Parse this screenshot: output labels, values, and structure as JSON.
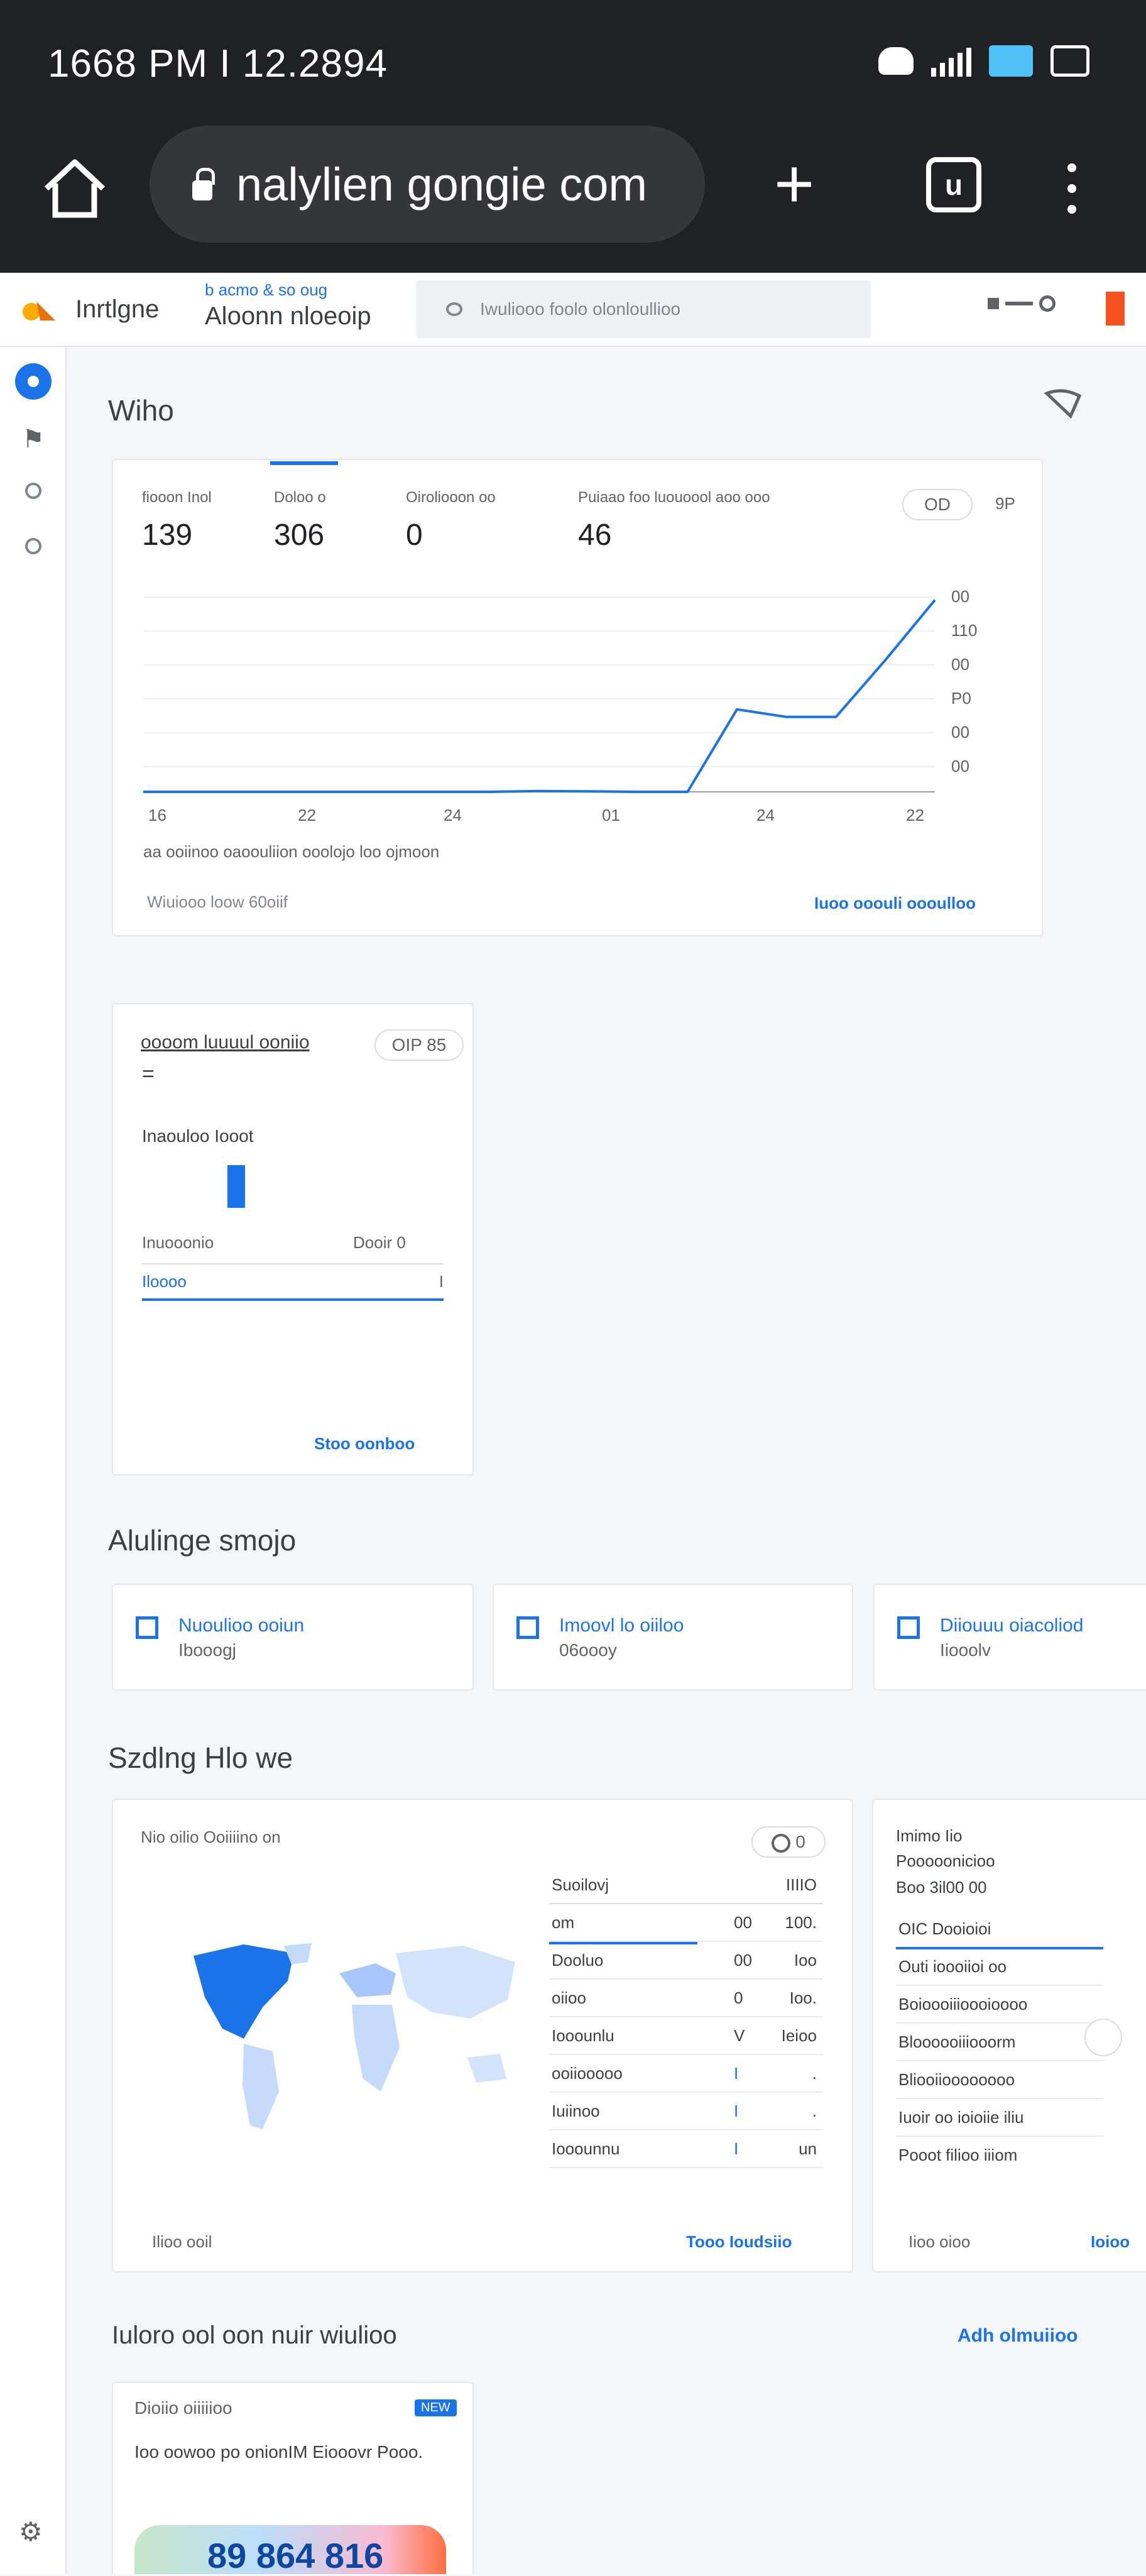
{
  "status": {
    "time": "1668 PM I 12.2894"
  },
  "browser": {
    "url": "nalylien gongie com",
    "tab_count": "u"
  },
  "header": {
    "app_name": "Inrtlgne",
    "account": "b acmo & so oug",
    "property": "Aloonn nloeoip",
    "search_placeholder": "Iwuliooo foolo olonloullioo"
  },
  "overview": {
    "title": "Wiho",
    "metrics": [
      {
        "label": "fiooon Inol",
        "value": "139"
      },
      {
        "label": "Doloo o",
        "value": "306"
      },
      {
        "label": "Oiroliooon oo",
        "value": "0"
      },
      {
        "label": "Puiaao foo luouoool aoo ooo",
        "value": "46"
      }
    ],
    "period_pill": "OD",
    "period_right": "9P",
    "y_ticks": [
      "00",
      "110",
      "00",
      "P0",
      "00",
      "00"
    ],
    "x_ticks": [
      "16",
      "22",
      "24",
      "01",
      "24",
      "22"
    ],
    "caption": "aa ooiinoo oaoouliion ooolojo loo ojmoon",
    "footer_left": "Wiuiooo loow 60oiif",
    "footer_right": "Iuoo ooouli oooulloo"
  },
  "chart_data": {
    "type": "line",
    "x": [
      "16",
      "22",
      "24",
      "01",
      "24",
      "22"
    ],
    "series": [
      {
        "values": [
          0,
          0,
          0,
          0,
          0,
          0,
          0,
          0,
          0.5,
          0.3,
          0,
          0,
          55,
          50,
          50,
          88,
          128
        ]
      }
    ],
    "ylim": [
      0,
      130
    ]
  },
  "realtime": {
    "title": "oooom luuuul ooniio",
    "subtitle": "=",
    "pill": "OIP 85",
    "bar_label": "Inaouloo Iooot",
    "bar_value": 0.85,
    "row_left": "Inuooonio",
    "row_right": "Dooir 0",
    "row2_left": "Iloooo",
    "row2_right": "I",
    "link": "Stoo oonboo"
  },
  "quick_access": {
    "title": "Alulinge smojo",
    "items": [
      {
        "title": "Nuoulioo ooiun",
        "subtitle": "Ibooogj"
      },
      {
        "title": "Imoovl lo oiiloo",
        "subtitle": "06oooy"
      },
      {
        "title": "Diiouuu oiacoliod",
        "subtitle": "Iiooolv"
      }
    ]
  },
  "users": {
    "title": "Szdlng Hlo we",
    "card_title": "Nio oilio Ooiiiino on",
    "pill": "0",
    "table_header": {
      "c1": "Suoilovj",
      "c3": "IIIIO"
    },
    "rows": [
      {
        "c1": "om",
        "c2": "00",
        "c3": "100."
      },
      {
        "c1": "Dooluo",
        "c2": "00",
        "c3": "Ioo"
      },
      {
        "c1": "oiioo",
        "c2": "0",
        "c3": "Ioo."
      },
      {
        "c1": "Iooounlu",
        "c2": "V",
        "c3": "Ieioo"
      },
      {
        "c1": "ooiiooooo",
        "c2": "I",
        "c3": "."
      },
      {
        "c1": "Iuiinoo",
        "c2": "I",
        "c3": "."
      },
      {
        "c1": "Iooounnu",
        "c2": "I",
        "c3": "un"
      }
    ],
    "footer_left": "Ilioo ooil",
    "footer_right": "Tooo Ioudsiio",
    "side": {
      "head1": "Imimo Iio",
      "head2": "Pooooonicioo",
      "head3": "Boo 3il00 00",
      "rows": [
        "OIC Dooioioi",
        "Outi ioooiioi oo",
        "Boioooiiioooioooo",
        "Bloooooiiiooorm",
        "Bliooiioooooooo",
        "Iuoir oo ioioiie iliu",
        "Pooot filioo iiiom"
      ],
      "footer_left": "Iioo oioo",
      "footer_right": "Ioioo"
    }
  },
  "insights": {
    "title": "Iuloro ool oon nuir wiulioo",
    "link": "Adh olmuiioo",
    "card_title": "Dioiio oiiiiioo",
    "badge": "NEW",
    "body": "Ioo oowoo po onionIM Eiooovr Pooo.",
    "big_number": "89 864 816"
  }
}
